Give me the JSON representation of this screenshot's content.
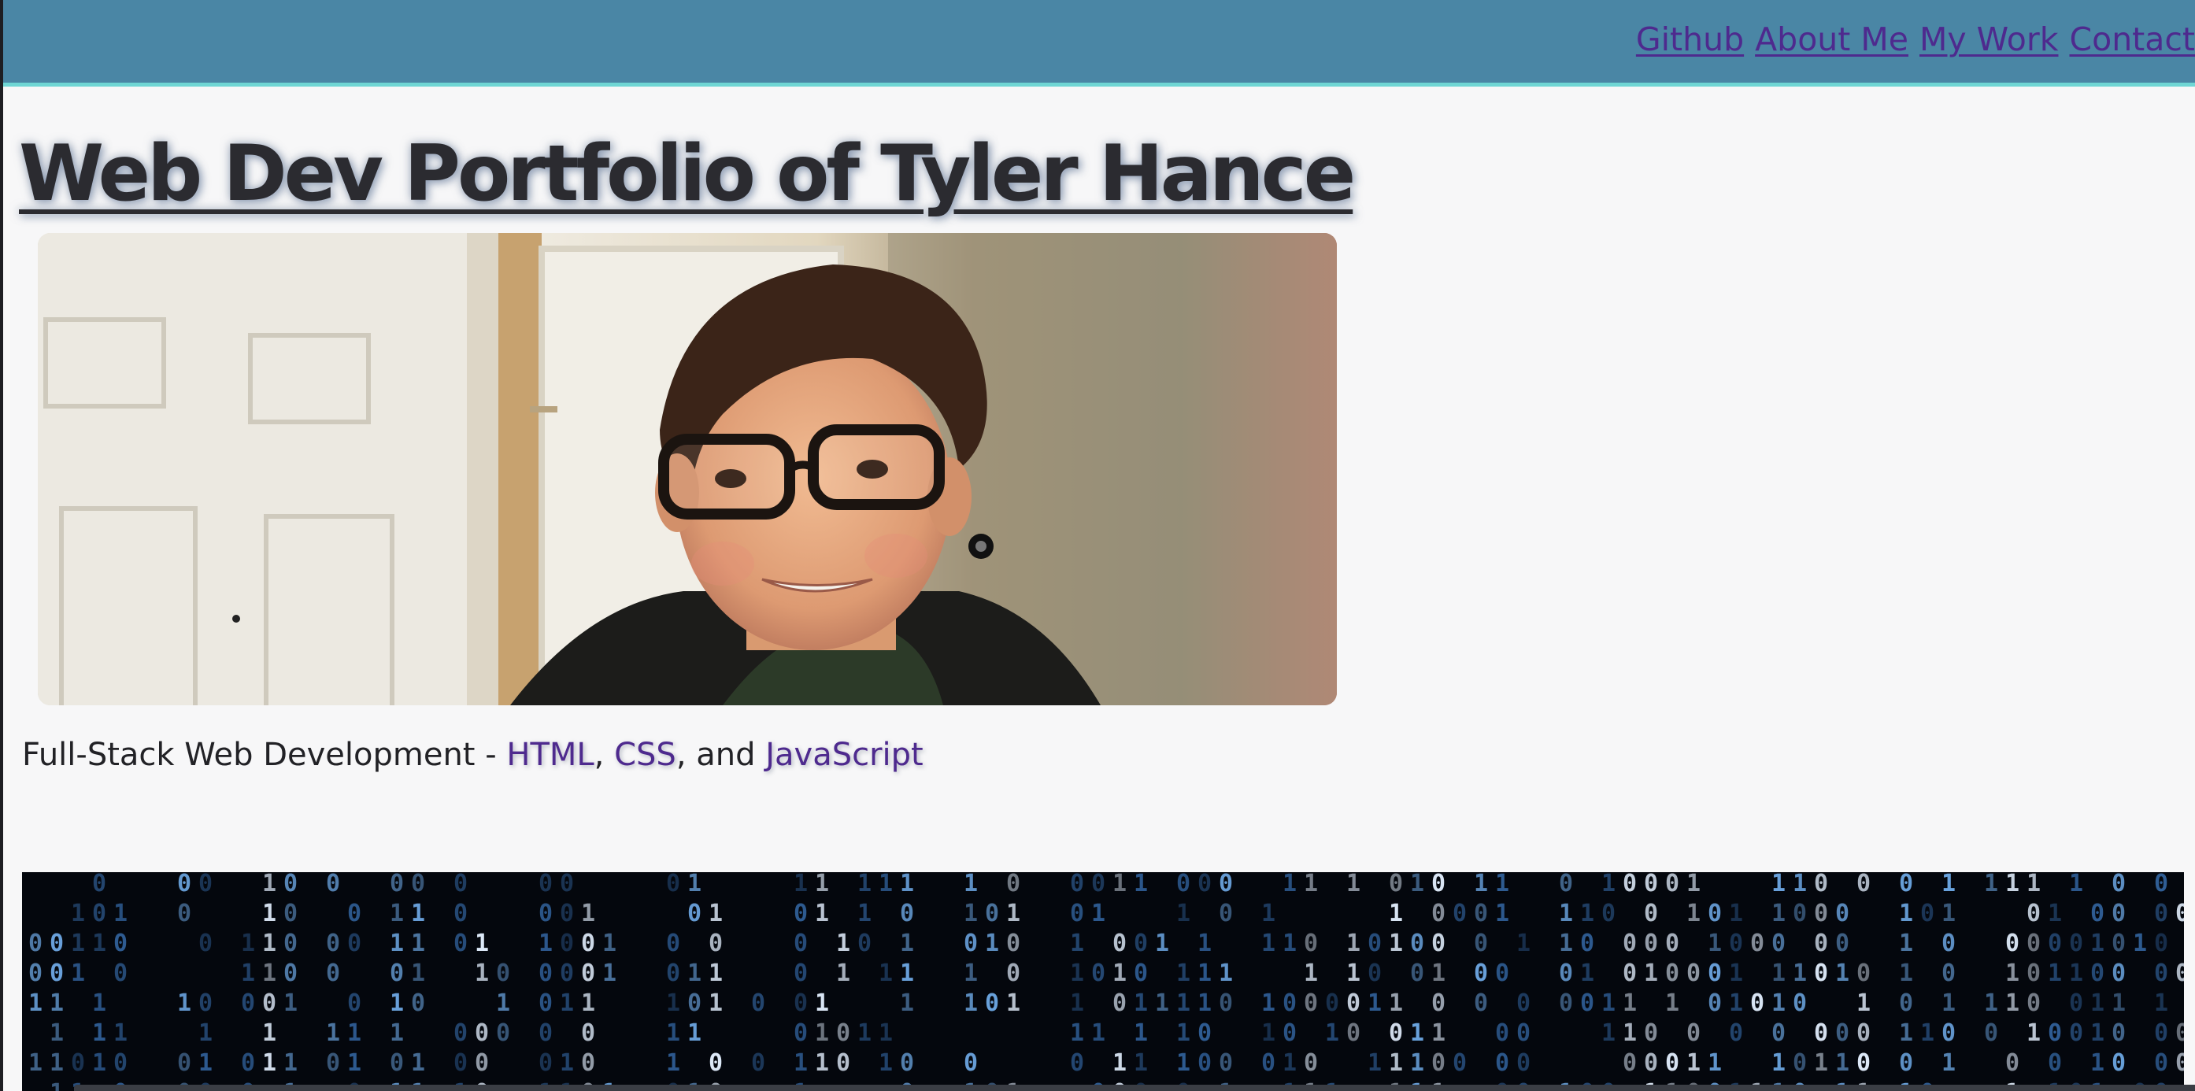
{
  "nav": {
    "items": [
      {
        "label": "Github"
      },
      {
        "label": "About Me"
      },
      {
        "label": "My Work"
      },
      {
        "label": "Contact"
      }
    ]
  },
  "hero": {
    "title": "Web Dev Portfolio of Tyler Hance",
    "photo_alt": "Portrait photo"
  },
  "tagline": {
    "prefix": "Full-Stack Web Development - ",
    "link1": "HTML",
    "sep1": ", ",
    "link2": "CSS",
    "sep2": ", and ",
    "link3": "JavaScript"
  },
  "colors": {
    "header_bg": "#4a86a5",
    "header_border": "#6fd6d4",
    "link": "#4e2a8e",
    "page_bg": "#f7f7f8",
    "title": "#2b2b30"
  }
}
